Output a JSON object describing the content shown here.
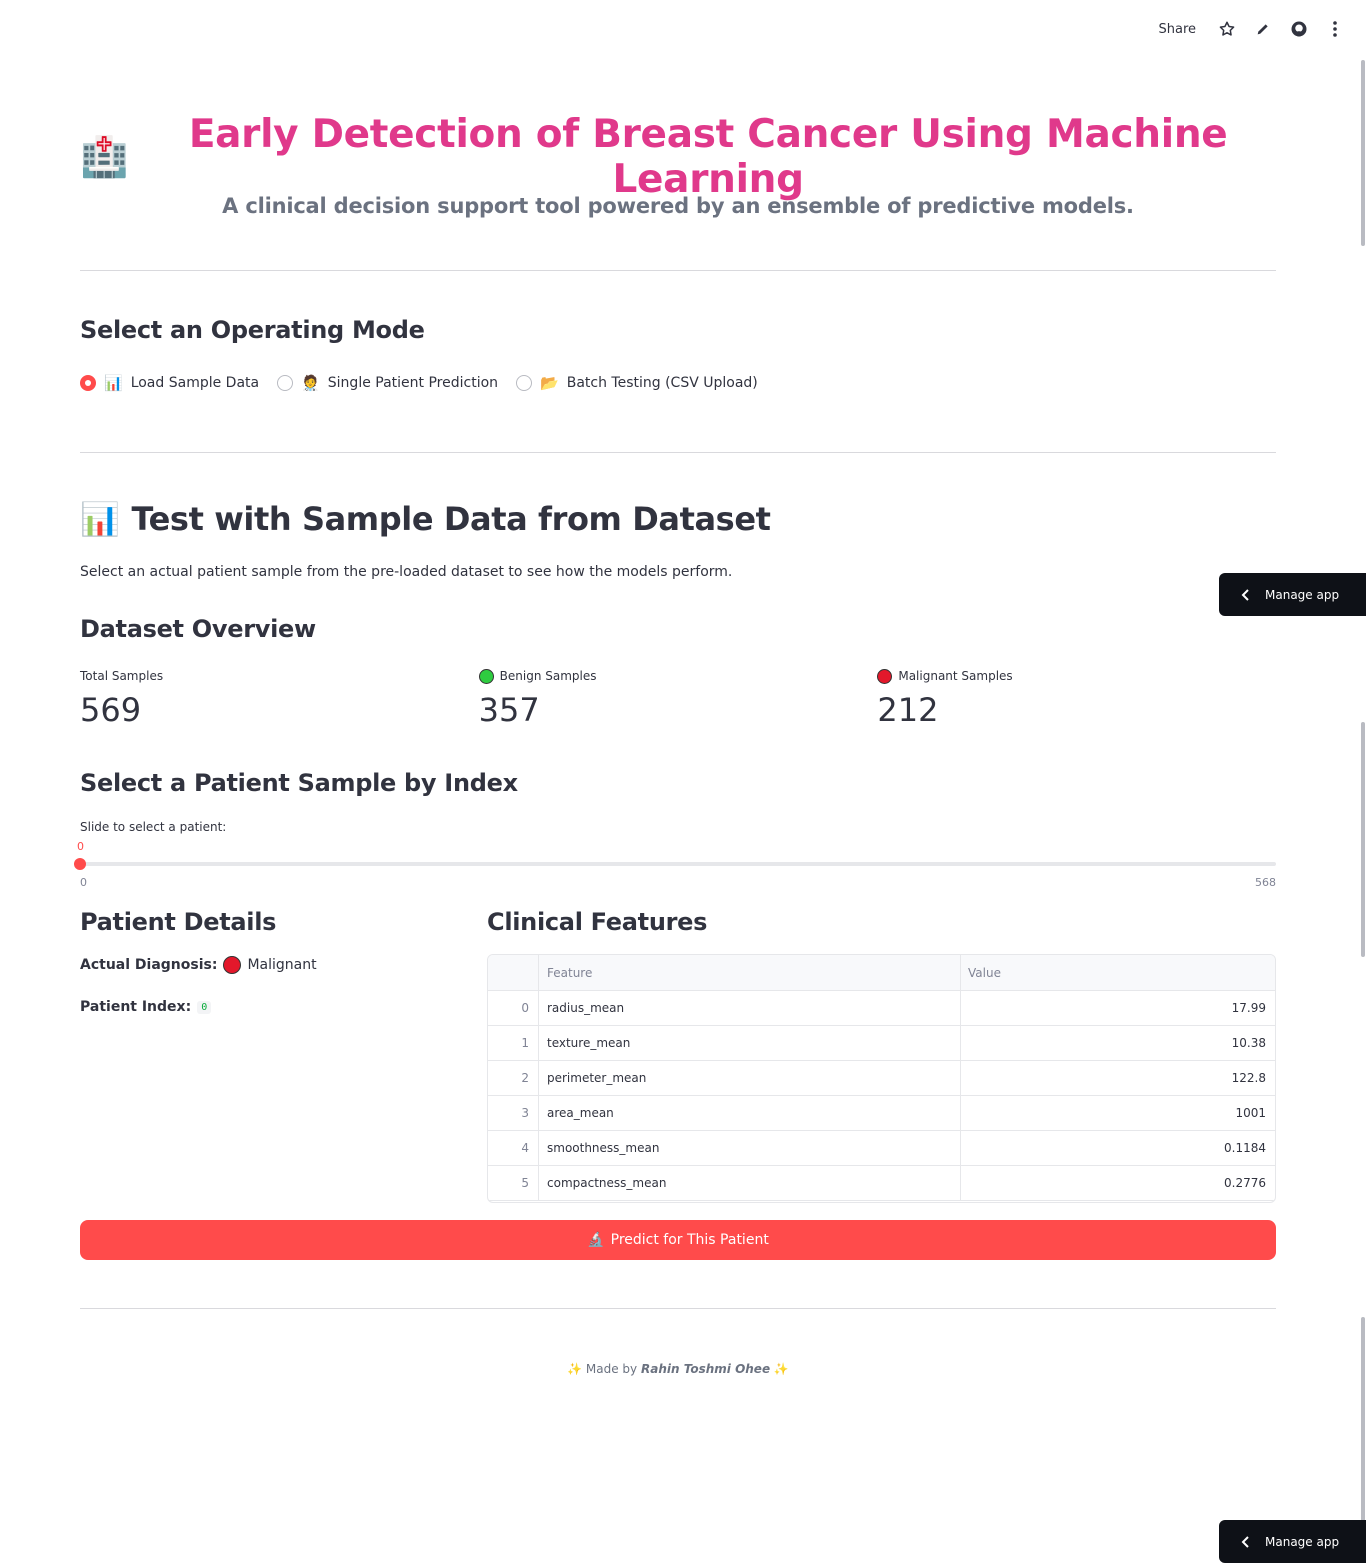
{
  "toolbar": {
    "share_label": "Share"
  },
  "header": {
    "title_emoji": "🏥",
    "title": "Early Detection of Breast Cancer Using Machine Learning",
    "subtitle": "A clinical decision support tool powered by an ensemble of predictive models."
  },
  "mode": {
    "heading": "Select an Operating Mode",
    "options": [
      {
        "emoji": "📊",
        "label": "Load Sample Data",
        "selected": true
      },
      {
        "emoji": "🧑‍⚕️",
        "label": "Single Patient Prediction",
        "selected": false
      },
      {
        "emoji": "📂",
        "label": "Batch Testing (CSV Upload)",
        "selected": false
      }
    ]
  },
  "sample": {
    "heading_emoji": "📊",
    "heading": "Test with Sample Data from Dataset",
    "description": "Select an actual patient sample from the pre-loaded dataset to see how the models perform."
  },
  "overview": {
    "heading": "Dataset Overview",
    "metrics": [
      {
        "label": "Total Samples",
        "value": "569",
        "dot": ""
      },
      {
        "label": "Benign Samples",
        "value": "357",
        "dot": "green"
      },
      {
        "label": "Malignant Samples",
        "value": "212",
        "dot": "red"
      }
    ]
  },
  "selector": {
    "heading": "Select a Patient Sample by Index",
    "slider_label": "Slide to select a patient:",
    "value": "0",
    "min": "0",
    "max": "568"
  },
  "patient": {
    "heading": "Patient Details",
    "diagnosis_label": "Actual Diagnosis:",
    "diagnosis_value": "Malignant",
    "index_label": "Patient Index:",
    "index_value": "0"
  },
  "clinical": {
    "heading": "Clinical Features",
    "columns": [
      "",
      "Feature",
      "Value"
    ],
    "rows": [
      {
        "idx": "0",
        "feature": "radius_mean",
        "value": "17.99"
      },
      {
        "idx": "1",
        "feature": "texture_mean",
        "value": "10.38"
      },
      {
        "idx": "2",
        "feature": "perimeter_mean",
        "value": "122.8"
      },
      {
        "idx": "3",
        "feature": "area_mean",
        "value": "1001"
      },
      {
        "idx": "4",
        "feature": "smoothness_mean",
        "value": "0.1184"
      },
      {
        "idx": "5",
        "feature": "compactness_mean",
        "value": "0.2776"
      }
    ]
  },
  "predict_button": {
    "emoji": "🔬",
    "label": "Predict for This Patient"
  },
  "footer": {
    "prefix": "Made by",
    "author": "Rahin Toshmi Ohee",
    "emoji": "✨"
  },
  "manage_app": {
    "label": "Manage app"
  },
  "colors": {
    "accent": "#ff4b4b",
    "title": "#e0398b",
    "benign": "#2ecc40",
    "malignant": "#e3182b"
  }
}
